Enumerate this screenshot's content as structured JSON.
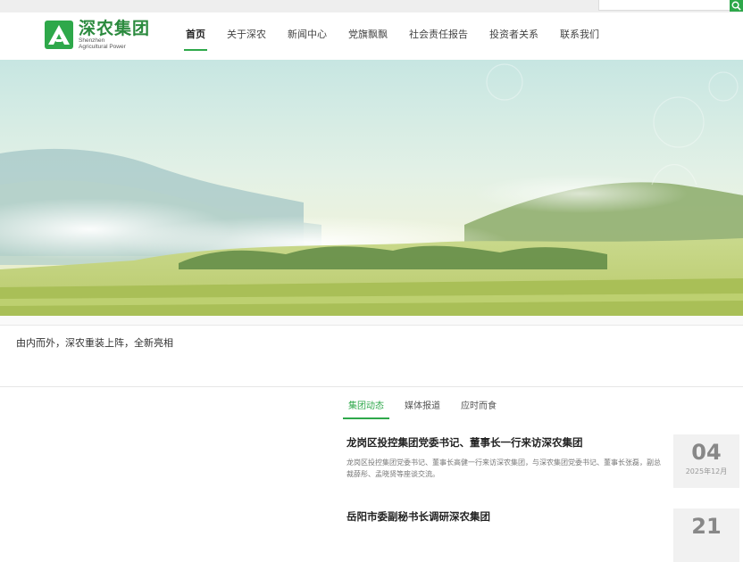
{
  "brand": {
    "name_cn": "深农集团",
    "name_en_line1": "Shenzhen",
    "name_en_line2": "Agricultural Power",
    "color": "#2ea84a"
  },
  "search": {
    "placeholder": "",
    "icon": "search-icon"
  },
  "nav": {
    "items": [
      "首页",
      "关于深农",
      "新闻中心",
      "党旗飘飘",
      "社会责任报告",
      "投资者关系",
      "联系我们"
    ],
    "active_index": 0
  },
  "banner": {
    "slogan": "由内而外，深农重装上阵，全新亮相"
  },
  "news": {
    "tabs": [
      "集团动态",
      "媒体报道",
      "应时而食"
    ],
    "active_tab": 0,
    "items": [
      {
        "title": "龙岗区投控集团党委书记、董事长一行来访深农集团",
        "summary": "龙岗区投控集团党委书记、董事长高健一行来访深农集团，与深农集团党委书记、董事长张磊，副总裁薛彤、孟晓贤等座谈交流。",
        "day": "04",
        "year_month": "2025年12月"
      },
      {
        "title": "岳阳市委副秘书长调研深农集团",
        "summary": "",
        "day": "21",
        "year_month": ""
      }
    ]
  }
}
